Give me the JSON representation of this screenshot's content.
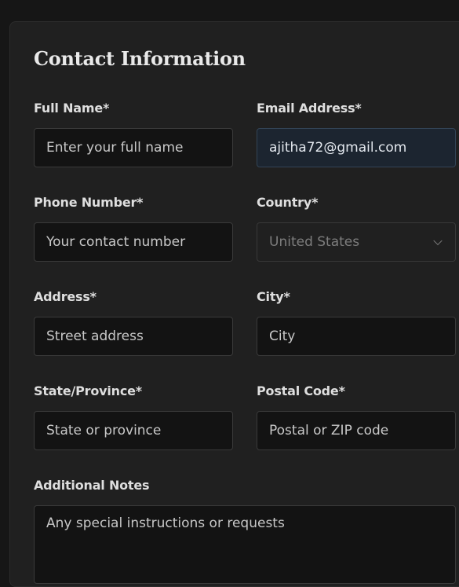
{
  "form": {
    "title": "Contact Information",
    "full_name": {
      "label": "Full Name*",
      "placeholder": "Enter your full name",
      "value": ""
    },
    "email": {
      "label": "Email Address*",
      "placeholder": "",
      "value": "ajitha72@gmail.com"
    },
    "phone": {
      "label": "Phone Number*",
      "placeholder": "Your contact number",
      "value": ""
    },
    "country": {
      "label": "Country*",
      "selected": "United States"
    },
    "address": {
      "label": "Address*",
      "placeholder": "Street address",
      "value": ""
    },
    "city": {
      "label": "City*",
      "placeholder": "City",
      "value": ""
    },
    "state": {
      "label": "State/Province*",
      "placeholder": "State or province",
      "value": ""
    },
    "postal": {
      "label": "Postal Code*",
      "placeholder": "Postal or ZIP code",
      "value": ""
    },
    "notes": {
      "label": "Additional Notes",
      "placeholder": "Any special instructions or requests"
    }
  },
  "colors": {
    "background": "#161616",
    "card": "#202020",
    "input_bg": "#131313",
    "input_filled_bg": "#1c2530"
  }
}
